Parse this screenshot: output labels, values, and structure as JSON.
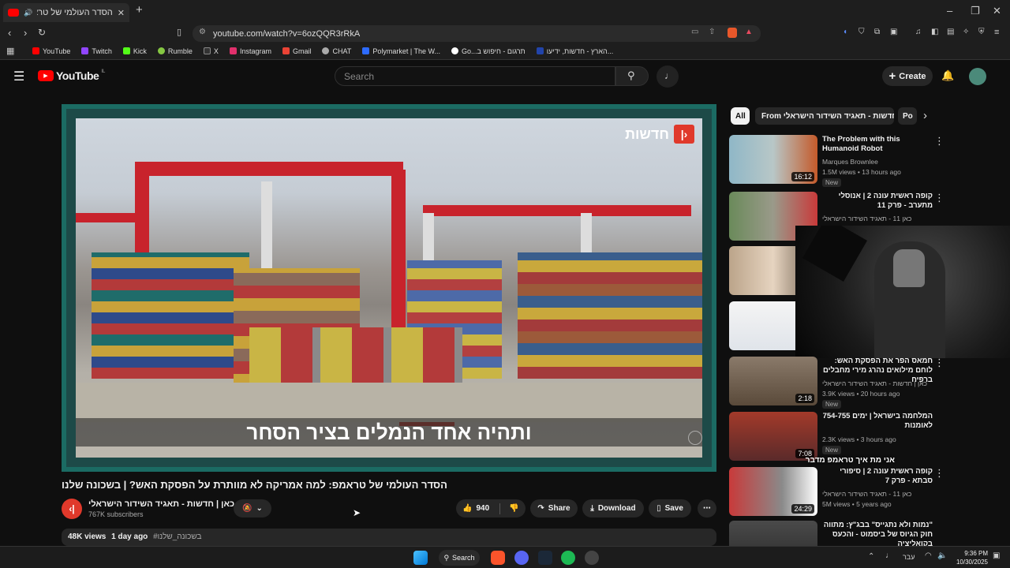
{
  "browser": {
    "tab_title": "הסדר העולמי של טראמפ: למה",
    "url": "youtube.com/watch?v=6ozQQR3rRkA",
    "bookmarks": [
      {
        "label": "YouTube",
        "color": "#ff0000"
      },
      {
        "label": "Twitch",
        "color": "#9146ff"
      },
      {
        "label": "Kick",
        "color": "#53fc18"
      },
      {
        "label": "Rumble",
        "color": "#85c742"
      },
      {
        "label": "X",
        "color": "#dddddd"
      },
      {
        "label": "Instagram",
        "color": "#e1306c"
      },
      {
        "label": "Gmail",
        "color": "#ea4335"
      },
      {
        "label": "CHAT",
        "color": "#aaaaaa"
      },
      {
        "label": "Polymarket | The W...",
        "color": "#2d6bff"
      },
      {
        "label": "Go...תרגום - חיפוש ב",
        "color": "#4285f4"
      },
      {
        "label": "הארץ - חדשות, ידיעו...",
        "color": "#2244aa"
      }
    ]
  },
  "header": {
    "logo": "YouTube",
    "country": "IL",
    "search_placeholder": "Search",
    "create_label": "Create"
  },
  "video": {
    "news_label": "חדשות",
    "subtitle": "ותהיה אחד הנמלים בציר הסחר",
    "title": "הסדר העולמי של טראמפ: למה אמריקה לא מוותרת על הפסקת האש? | בשכונה שלנו",
    "channel": "כאן | חדשות - תאגיד השידור הישראלי",
    "subscribers": "767K subscribers",
    "likes": "940",
    "share_label": "Share",
    "download_label": "Download",
    "save_label": "Save",
    "views": "48K views",
    "age": "1 day ago",
    "hashtag": "#בשכונה_שלנו"
  },
  "sidebar": {
    "chips": [
      "All",
      "From כאן | חדשות - תאגיד השידור הישראלי",
      "Po"
    ],
    "recommendations": [
      {
        "title": "The Problem with this Humanoid Robot",
        "channel": "Marques Brownlee",
        "meta": "1.5M views • 13 hours ago",
        "badge": "New",
        "duration": "16:12"
      },
      {
        "title": "קופה ראשית עונה 2 | אנוסלי מתערב - פרק 11",
        "channel": "כאן 11 - תאגיד השידור הישראלי",
        "meta": "",
        "badge": "",
        "duration": ""
      },
      {
        "title": "",
        "channel": "",
        "meta": "",
        "badge": "",
        "duration": ""
      },
      {
        "title": "",
        "channel": "",
        "meta": "",
        "badge": "",
        "duration": ""
      },
      {
        "title": "חמאס הפר את הפסקת האש: לוחם מילואים נהרג מירי מחבלים ברפיח",
        "channel": "כאן | חדשות - תאגיד השידור הישראלי",
        "meta": "3.9K views • 20 hours ago",
        "badge": "New",
        "duration": "2:18"
      },
      {
        "title": "המלחמה בישראל | ימים 754-755 לאומנות",
        "channel": "",
        "meta": "2.3K views • 3 hours ago",
        "badge": "New",
        "duration": "7:08"
      },
      {
        "title": "קופה ראשית עונה 2 | סיפורי סבתא - פרק 7",
        "channel": "כאן 11 - תאגיד השידור הישראלי",
        "meta": "5M views • 5 years ago",
        "badge": "",
        "duration": "24:29"
      },
      {
        "title": "\"נמות ולא נתגייס\" בבג\"ץ: מתווה חוק הגיוס של ביסמוט - והכעס בקואליציה",
        "channel": "",
        "meta": "",
        "badge": "",
        "duration": ""
      }
    ],
    "overlay_caption": "אני מת איך טראמפ מדבר"
  },
  "taskbar": {
    "search_label": "Search",
    "lang": "עבר",
    "time": "9:36 PM",
    "date": "10/30/2025"
  }
}
